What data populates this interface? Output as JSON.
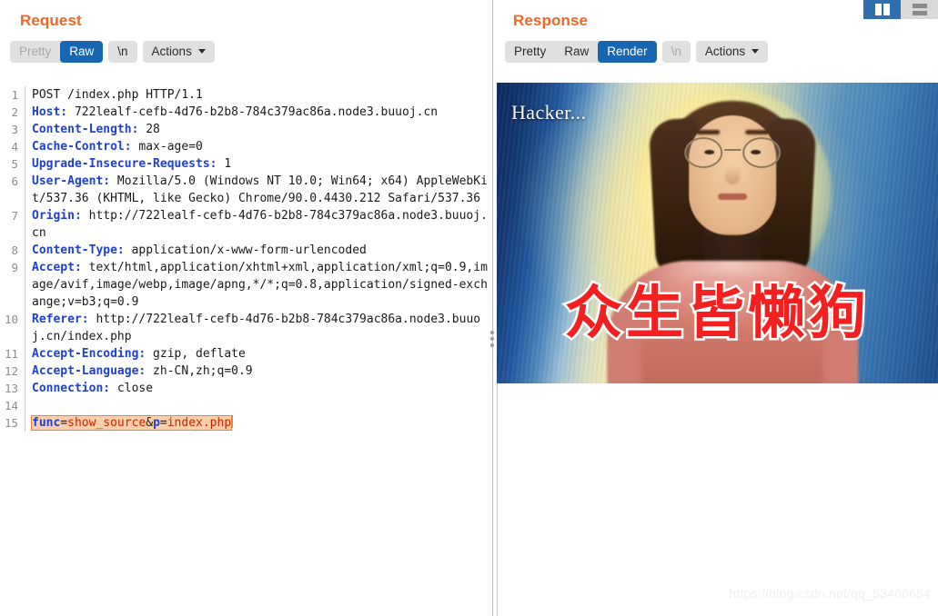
{
  "window": {
    "layout_toggles": [
      {
        "name": "vertical-split",
        "active": true
      },
      {
        "name": "horizontal-split",
        "active": false
      }
    ]
  },
  "request": {
    "title": "Request",
    "tabs": [
      {
        "label": "Pretty",
        "active": false,
        "disabled": true
      },
      {
        "label": "Raw",
        "active": true,
        "disabled": false
      }
    ],
    "newline_button": "\\n",
    "actions_button": "Actions",
    "lines": [
      {
        "num": "1",
        "type": "start",
        "text": "POST /index.php HTTP/1.1"
      },
      {
        "num": "2",
        "type": "header",
        "name": "Host",
        "value": "722lealf-cefb-4d76-b2b8-784c379ac86a.node3.buuoj.cn"
      },
      {
        "num": "3",
        "type": "header",
        "name": "Content-Length",
        "value": "28"
      },
      {
        "num": "4",
        "type": "header",
        "name": "Cache-Control",
        "value": "max-age=0"
      },
      {
        "num": "5",
        "type": "header",
        "name": "Upgrade-Insecure-Requests",
        "value": "1"
      },
      {
        "num": "6",
        "type": "header",
        "name": "User-Agent",
        "value": "Mozilla/5.0 (Windows NT 10.0; Win64; x64) AppleWebKit/537.36 (KHTML, like Gecko) Chrome/90.0.4430.212 Safari/537.36"
      },
      {
        "num": "7",
        "type": "header",
        "name": "Origin",
        "value": "http://722lealf-cefb-4d76-b2b8-784c379ac86a.node3.buuoj.cn"
      },
      {
        "num": "8",
        "type": "header",
        "name": "Content-Type",
        "value": "application/x-www-form-urlencoded"
      },
      {
        "num": "9",
        "type": "header",
        "name": "Accept",
        "value": "text/html,application/xhtml+xml,application/xml;q=0.9,image/avif,image/webp,image/apng,*/*;q=0.8,application/signed-exchange;v=b3;q=0.9"
      },
      {
        "num": "10",
        "type": "header",
        "name": "Referer",
        "value": "http://722lealf-cefb-4d76-b2b8-784c379ac86a.node3.buuoj.cn/index.php"
      },
      {
        "num": "11",
        "type": "header",
        "name": "Accept-Encoding",
        "value": "gzip, deflate"
      },
      {
        "num": "12",
        "type": "header",
        "name": "Accept-Language",
        "value": "zh-CN,zh;q=0.9"
      },
      {
        "num": "13",
        "type": "header",
        "name": "Connection",
        "value": "close"
      },
      {
        "num": "14",
        "type": "blank",
        "text": ""
      },
      {
        "num": "15",
        "type": "body",
        "text": "func=show_source&p=index.php",
        "params": [
          {
            "key": "func",
            "value": "show_source"
          },
          {
            "key": "p",
            "value": "index.php"
          }
        ]
      }
    ]
  },
  "response": {
    "title": "Response",
    "tabs": [
      {
        "label": "Pretty",
        "active": false,
        "disabled": false
      },
      {
        "label": "Raw",
        "active": false,
        "disabled": false
      },
      {
        "label": "Render",
        "active": true,
        "disabled": false
      }
    ],
    "newline_button": "\\n",
    "actions_button": "Actions",
    "rendered_page": {
      "overlay_text_top_left": "Hacker...",
      "overlay_text_center": "众生皆懒狗"
    }
  },
  "watermark": "https://blog.csdn.net/qq_53460654",
  "colors": {
    "accent_orange": "#f26722",
    "active_tab_blue": "#1666b4",
    "header_name_blue": "#1f3fd0",
    "param_value_red": "#cc2200",
    "body_highlight": "#fbcfa9",
    "body_highlight_border": "#e8833c",
    "chip_gray": "#e0e0e0"
  }
}
